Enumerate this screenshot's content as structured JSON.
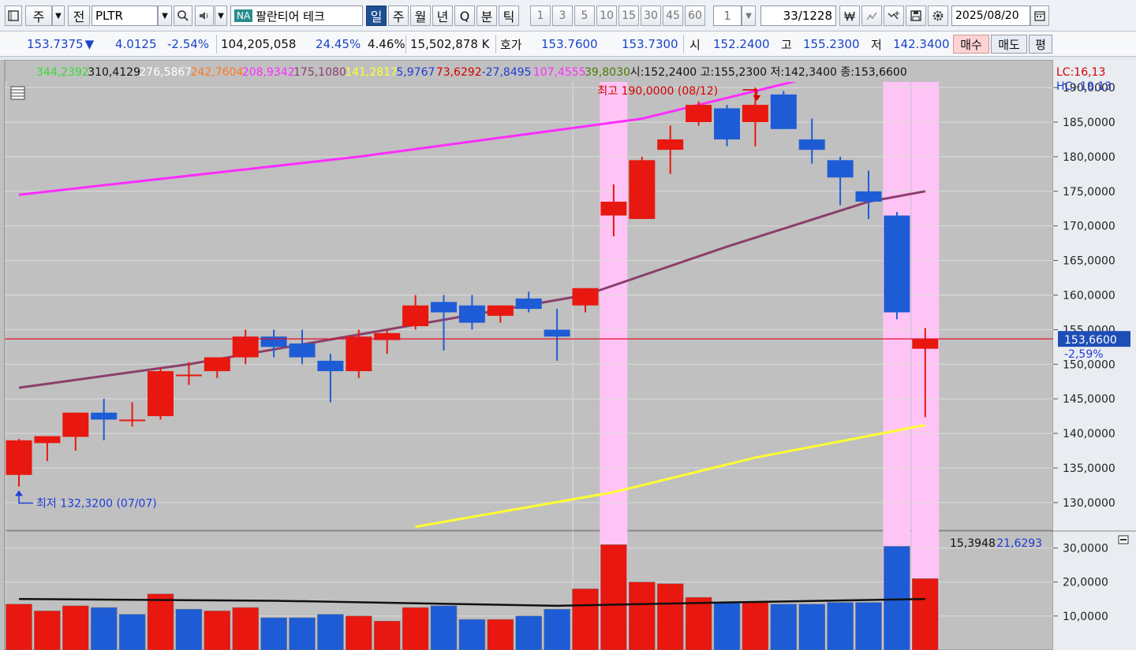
{
  "toolbar": {
    "period_label": "주",
    "prev_label": "전",
    "symbol": "PLTR",
    "name_badge": "NA",
    "stock_name": "팔란티어 테크",
    "timeframes": [
      "일",
      "주",
      "월",
      "년",
      "Q",
      "분",
      "틱"
    ],
    "intervals": [
      "1",
      "3",
      "5",
      "10",
      "15",
      "30",
      "45",
      "60"
    ],
    "count_value": "1",
    "page_current": "33",
    "page_total": "/1228",
    "date": "2025/08/20"
  },
  "quote": {
    "price": "153.7375",
    "down_arrow": "▼",
    "change": "4.0125",
    "change_pct": "-2.54%",
    "volume": "104,205,058",
    "rate1": "24.45%",
    "rate2": "4.46%",
    "amount": "15,502,878 K",
    "bid_label": "호가",
    "ask_price": "153.7600",
    "bid_price": "153.7300",
    "open_label": "시",
    "open": "152.2400",
    "high_label": "고",
    "high": "155.2300",
    "low_label": "저",
    "low": "142.3400",
    "buy_label": "매수",
    "sell_label": "매도",
    "avg_label": "평"
  },
  "colors": {
    "up": "#e8170f",
    "down": "#1e5cd6",
    "ma5": "#ff2cff",
    "ma20": "#8b3f6b",
    "ma60": "#ffff33",
    "highlight": "#ffc4f5",
    "price_line": "#e0102a"
  },
  "chart_data": {
    "type": "candlestick",
    "ylim": [
      126,
      194
    ],
    "y_ticks": [
      "190,0000",
      "185,0000",
      "180,0000",
      "175,0000",
      "170,0000",
      "165,0000",
      "160,0000",
      "155,0000",
      "150,0000",
      "145,0000",
      "140,0000",
      "135,0000",
      "130,0000"
    ],
    "y_tick_values": [
      190,
      185,
      180,
      175,
      170,
      165,
      160,
      155,
      150,
      145,
      140,
      135,
      130
    ],
    "candles": [
      {
        "o": 134.0,
        "h": 139.2,
        "l": 132.32,
        "c": 139.0
      },
      {
        "o": 138.6,
        "h": 139.6,
        "l": 136.0,
        "c": 139.6
      },
      {
        "o": 139.5,
        "h": 143.0,
        "l": 137.5,
        "c": 143.0
      },
      {
        "o": 143.0,
        "h": 145.0,
        "l": 139.0,
        "c": 142.0
      },
      {
        "o": 142.0,
        "h": 144.5,
        "l": 141.0,
        "c": 142.0
      },
      {
        "o": 142.5,
        "h": 149.5,
        "l": 142.0,
        "c": 149.0
      },
      {
        "o": 148.5,
        "h": 150.3,
        "l": 147.0,
        "c": 148.5
      },
      {
        "o": 149.0,
        "h": 151.0,
        "l": 148.0,
        "c": 151.0
      },
      {
        "o": 151.0,
        "h": 155.0,
        "l": 150.0,
        "c": 154.0
      },
      {
        "o": 154.0,
        "h": 155.0,
        "l": 151.0,
        "c": 152.5
      },
      {
        "o": 153.0,
        "h": 155.0,
        "l": 150.0,
        "c": 151.0
      },
      {
        "o": 150.5,
        "h": 151.5,
        "l": 144.5,
        "c": 149.0
      },
      {
        "o": 149.0,
        "h": 155.0,
        "l": 148.0,
        "c": 154.0
      },
      {
        "o": 153.5,
        "h": 155.0,
        "l": 151.5,
        "c": 154.5
      },
      {
        "o": 155.5,
        "h": 160.0,
        "l": 155.0,
        "c": 158.5
      },
      {
        "o": 159.0,
        "h": 160.0,
        "l": 152.0,
        "c": 157.5
      },
      {
        "o": 158.5,
        "h": 160.0,
        "l": 155.0,
        "c": 156.0
      },
      {
        "o": 157.0,
        "h": 158.5,
        "l": 156.0,
        "c": 158.5
      },
      {
        "o": 159.5,
        "h": 160.5,
        "l": 157.5,
        "c": 158.0
      },
      {
        "o": 155.0,
        "h": 158.0,
        "l": 150.5,
        "c": 154.0
      },
      {
        "o": 158.5,
        "h": 161.0,
        "l": 157.5,
        "c": 161.0
      },
      {
        "o": 171.5,
        "h": 176.0,
        "l": 168.5,
        "c": 173.5
      },
      {
        "o": 171.0,
        "h": 180.0,
        "l": 171.0,
        "c": 179.5
      },
      {
        "o": 181.0,
        "h": 184.5,
        "l": 177.5,
        "c": 182.5
      },
      {
        "o": 185.0,
        "h": 188.0,
        "l": 184.5,
        "c": 187.5
      },
      {
        "o": 187.0,
        "h": 187.5,
        "l": 181.5,
        "c": 182.5
      },
      {
        "o": 185.0,
        "h": 190.0,
        "l": 181.5,
        "c": 187.5
      },
      {
        "o": 189.0,
        "h": 189.5,
        "l": 184.0,
        "c": 184.0
      },
      {
        "o": 182.5,
        "h": 185.5,
        "l": 179.0,
        "c": 181.0
      },
      {
        "o": 179.5,
        "h": 180.0,
        "l": 173.0,
        "c": 177.0
      },
      {
        "o": 175.0,
        "h": 178.0,
        "l": 171.0,
        "c": 173.5
      },
      {
        "o": 171.5,
        "h": 172.0,
        "l": 156.5,
        "c": 157.5
      },
      {
        "o": 152.24,
        "h": 155.23,
        "l": 142.34,
        "c": 153.66
      }
    ],
    "ma5": [
      174.5,
      180.0,
      185.5,
      191.5
    ],
    "ma5_idx": [
      0,
      12,
      22,
      28
    ],
    "ma20": [
      146.6,
      150.0,
      155.0,
      160.0,
      167.0,
      173.5,
      175.0
    ],
    "ma20_idx": [
      0,
      6,
      13,
      20,
      25,
      30,
      32
    ],
    "ma60": [
      126.5,
      131.5,
      136.5,
      141.2
    ],
    "ma60_idx": [
      14,
      21,
      26,
      32
    ],
    "highlight_idx": [
      21,
      31,
      32
    ],
    "last_price": 153.66,
    "last_price_label": "153,6600",
    "last_change_label": "-2,59%",
    "annotation_high": "최고 190,0000 (08/12)",
    "annotation_low": "최저 132,3200 (07/07)",
    "legend_values": [
      {
        "text": "344,2392",
        "color": "#33dd33"
      },
      {
        "text": "310,4129",
        "color": "#111111"
      },
      {
        "text": "276,5867",
        "color": "#ffffff"
      },
      {
        "text": "242,7604",
        "color": "#ff7a1a"
      },
      {
        "text": "208,9342",
        "color": "#ff2cff"
      },
      {
        "text": "175,1080",
        "color": "#8b3f6b"
      },
      {
        "text": "141,2817",
        "color": "#ffff33"
      },
      {
        "text": "5,9767",
        "color": "#1e3cd6"
      },
      {
        "text": "73,6292",
        "color": "#d40000"
      },
      {
        "text": "-27,8495",
        "color": "#1e3cd6"
      },
      {
        "text": "107,4555",
        "color": "#ff2cff"
      },
      {
        "text": "39,8030",
        "color": "#4a7a00"
      },
      {
        "text": "시:152,2400 고:155,2300 저:142,3400 종:153,6600",
        "color": "#111111"
      }
    ],
    "lc_label": "LC:16,13",
    "hc_label": "HC:-19,13",
    "volume": {
      "ylim": [
        0,
        35
      ],
      "y_ticks": [
        "30,0000",
        "20,0000",
        "10,0000"
      ],
      "y_tick_values": [
        30,
        20,
        10
      ],
      "values": [
        13.5,
        11.5,
        13.0,
        12.5,
        10.5,
        16.5,
        12.0,
        11.5,
        12.5,
        9.5,
        9.5,
        10.5,
        10.0,
        8.5,
        12.5,
        13.0,
        9.0,
        9.0,
        10.0,
        12.0,
        18.0,
        31.0,
        20.0,
        19.5,
        15.5,
        14.0,
        14.0,
        13.5,
        13.5,
        14.0,
        14.0,
        30.5,
        21.0
      ],
      "up": [
        true,
        true,
        true,
        false,
        false,
        true,
        false,
        true,
        true,
        false,
        false,
        false,
        true,
        true,
        true,
        false,
        false,
        true,
        false,
        false,
        true,
        true,
        true,
        true,
        true,
        false,
        true,
        false,
        false,
        false,
        false,
        false,
        true
      ],
      "ma": [
        15.0,
        14.5,
        13.0,
        14.0,
        15.0
      ],
      "ma_idx": [
        0,
        9,
        19,
        25,
        32
      ],
      "legend": [
        {
          "text": "15,3948",
          "color": "#111111"
        },
        {
          "text": "21,6293",
          "color": "#1e3cd6"
        }
      ]
    }
  }
}
